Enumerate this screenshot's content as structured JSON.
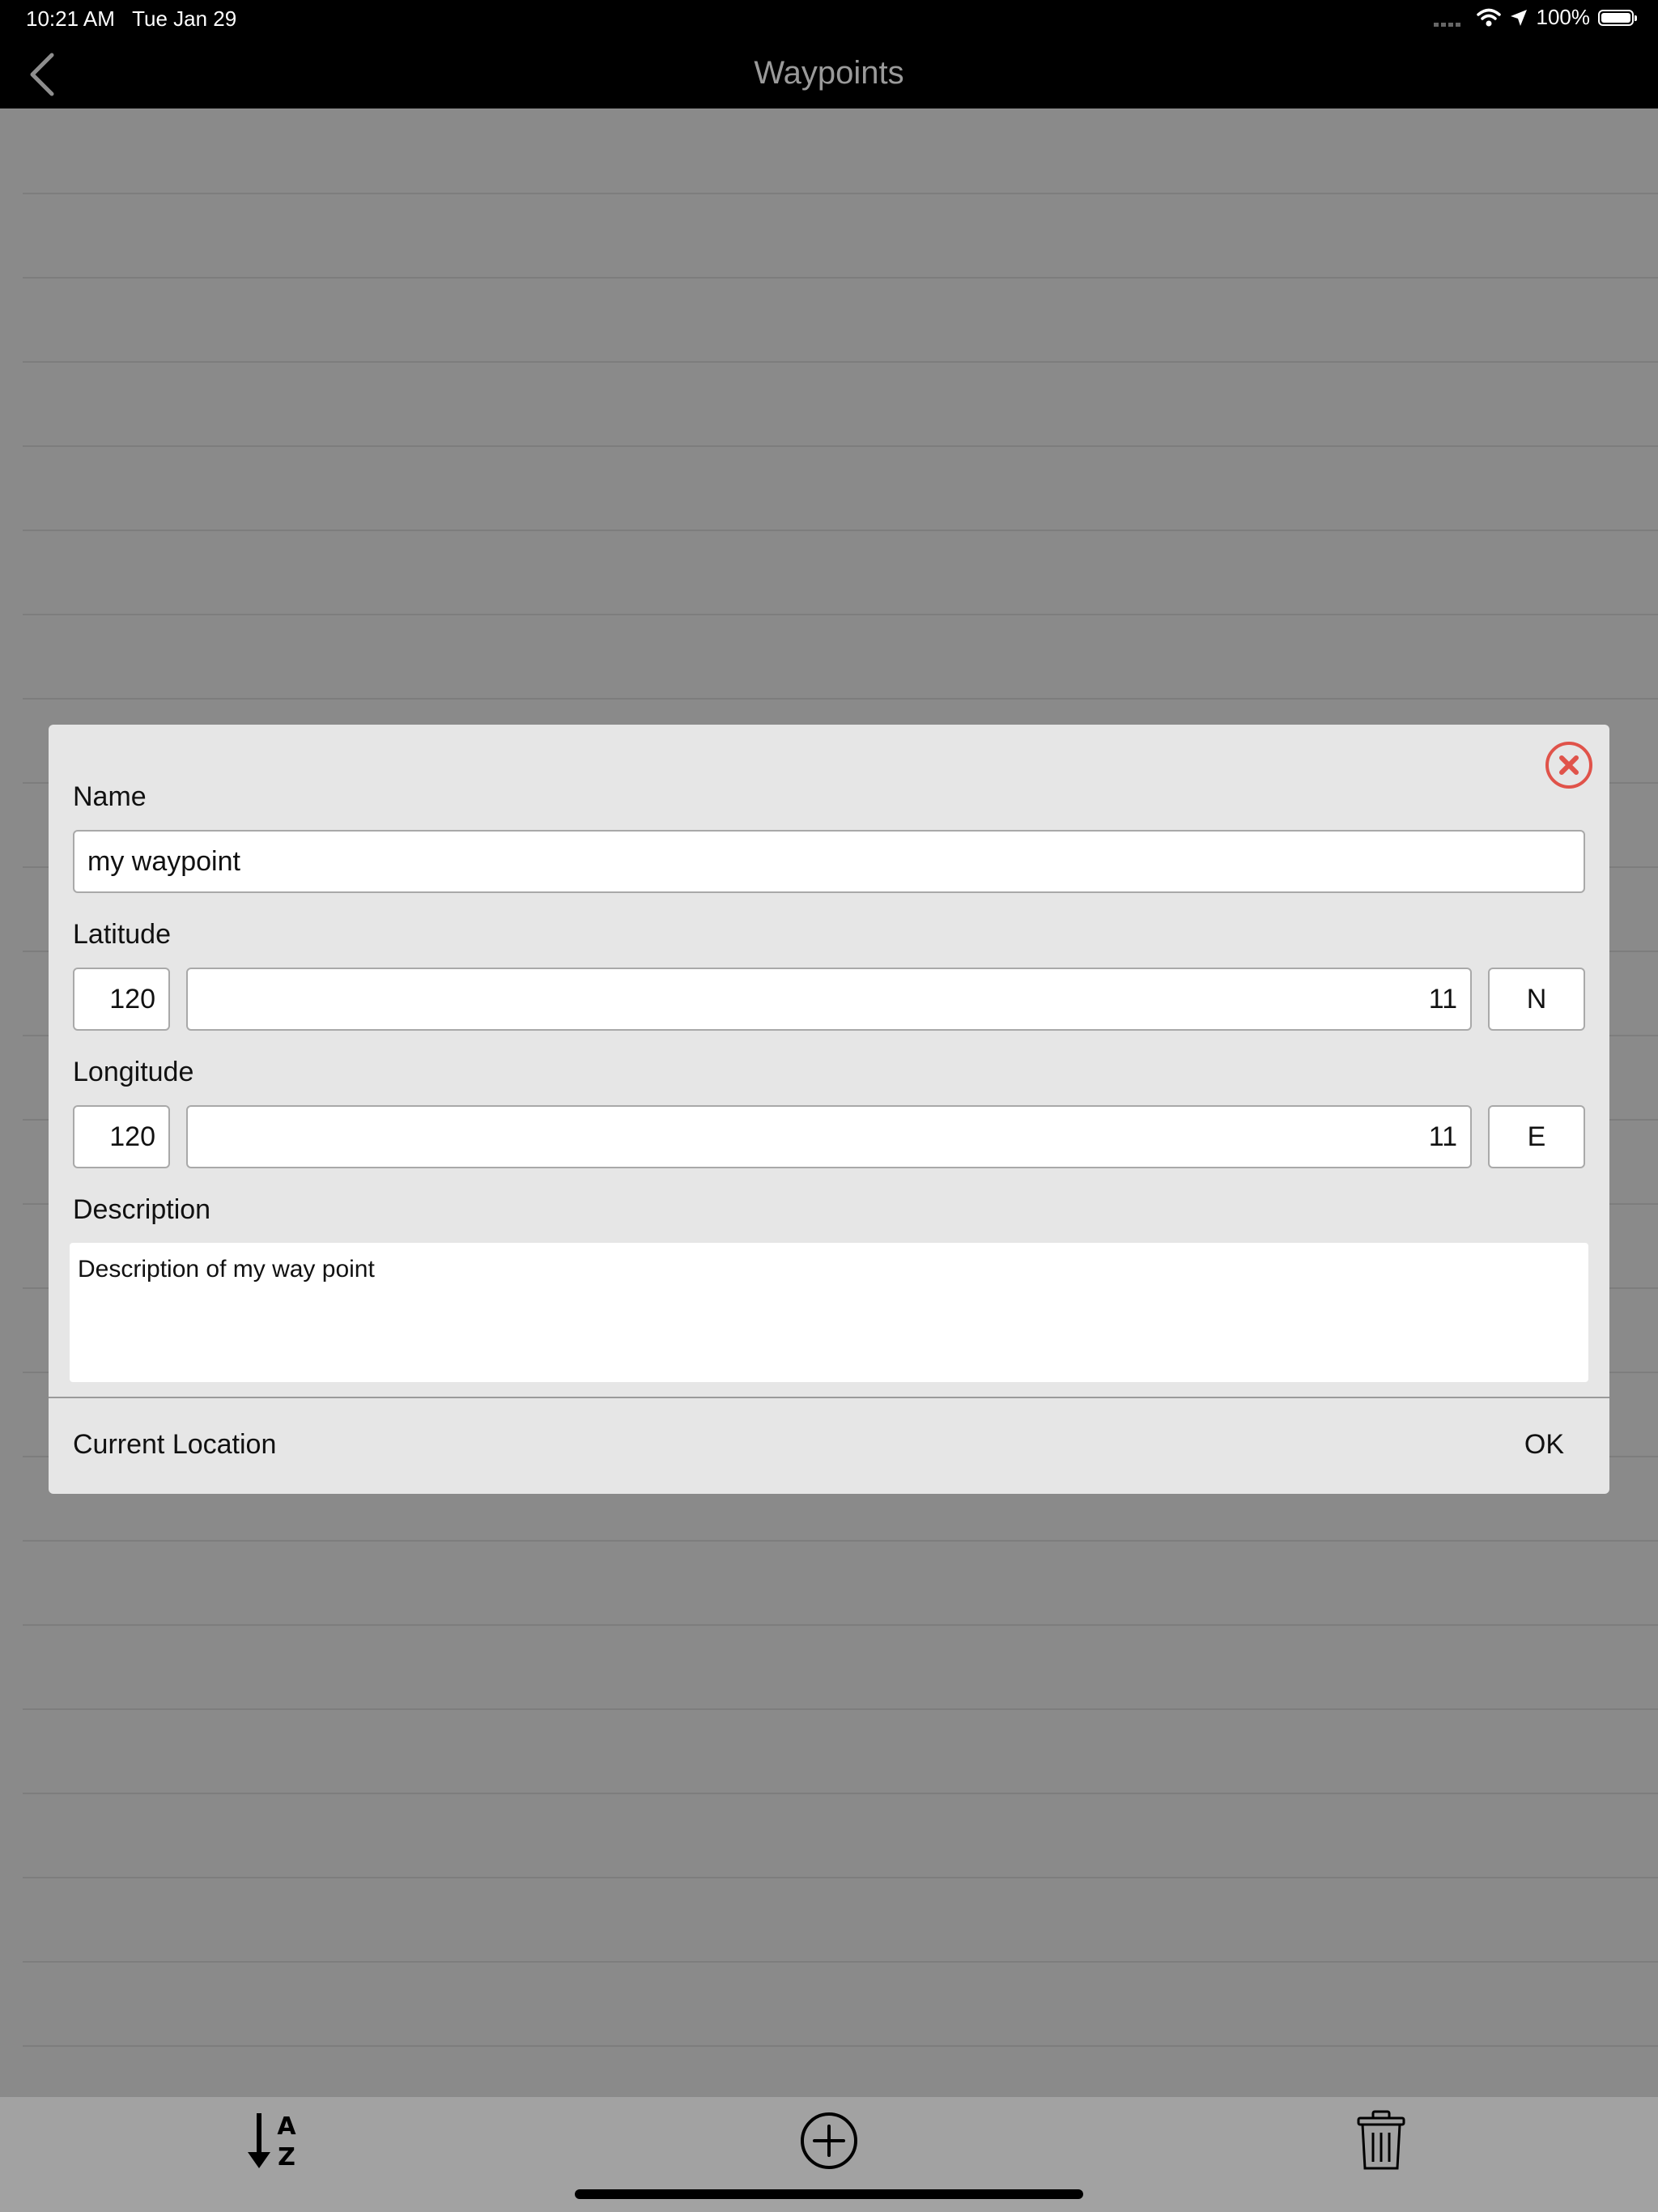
{
  "status_bar": {
    "time": "10:21 AM",
    "date": "Tue Jan 29",
    "battery": "100%",
    "wifi_icon": "wifi-icon",
    "location_icon": "location-arrow-icon",
    "battery_icon": "battery-icon"
  },
  "nav": {
    "title": "Waypoints",
    "back_icon": "chevron-left-icon"
  },
  "dialog": {
    "name_label": "Name",
    "name_value": "my waypoint",
    "latitude_label": "Latitude",
    "latitude_degrees": "120",
    "latitude_minutes": "11",
    "latitude_hemisphere": "N",
    "longitude_label": "Longitude",
    "longitude_degrees": "120",
    "longitude_minutes": "11",
    "longitude_hemisphere": "E",
    "description_label": "Description",
    "description_value": "Description of my way point",
    "current_location_label": "Current Location",
    "ok_label": "OK",
    "close_icon": "close-circle-icon",
    "accent_color": "#e0534a"
  },
  "toolbar": {
    "sort_icon": "sort-a-z-icon",
    "add_icon": "add-circle-icon",
    "delete_icon": "trash-icon"
  },
  "colors": {
    "background": "#8a8a8a",
    "bar": "#000000",
    "dialog": "#e6e6e6",
    "toolbar": "#a2a2a2"
  }
}
